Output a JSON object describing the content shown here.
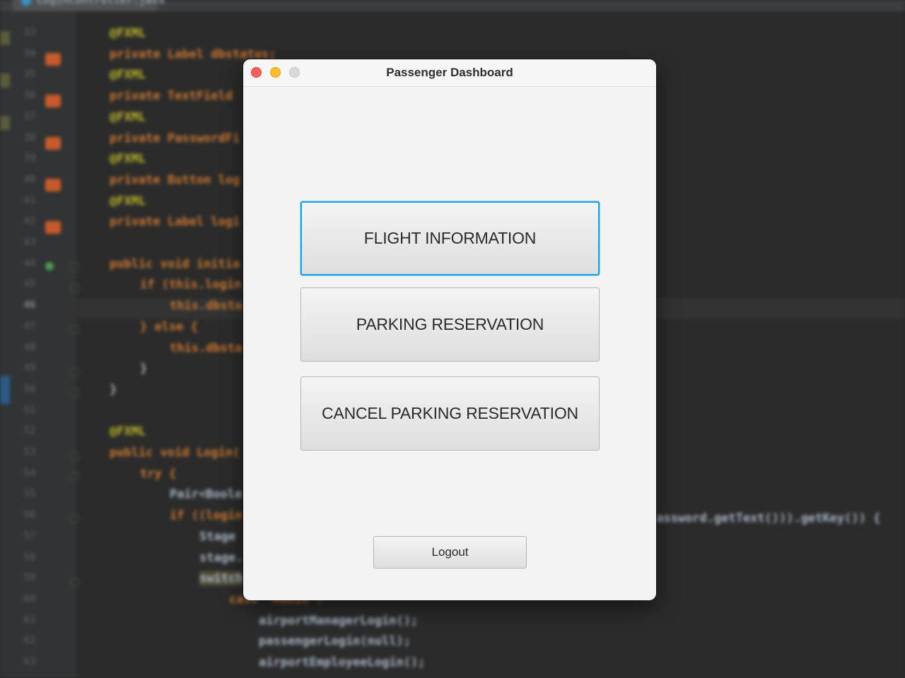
{
  "window": {
    "title": "Passenger Dashboard"
  },
  "buttons": {
    "flight_information": "FLIGHT INFORMATION",
    "parking_reservation": "PARKING RESERVATION",
    "cancel_parking_reservation": "CANCEL PARKING RESERVATION",
    "logout": "Logout"
  },
  "colors": {
    "focus_ring": "#1fa3e0",
    "close": "#fe5f57",
    "minimize": "#febc2e",
    "maximize": "#d9d9d9"
  },
  "background_editor": {
    "tab_label": "LoginController.java",
    "line_numbers": [
      "33",
      "34",
      "35",
      "36",
      "37",
      "38",
      "39",
      "40",
      "41",
      "42",
      "43",
      "44",
      "45",
      "46",
      "47",
      "48",
      "49",
      "50",
      "51",
      "52",
      "53",
      "54",
      "55",
      "56",
      "57",
      "58",
      "59",
      "60",
      "61",
      "62",
      "63"
    ],
    "code_lines": [
      "@FXML",
      "private Label dbstatus;",
      "@FXML",
      "private TextField",
      "@FXML",
      "private PasswordFi",
      "@FXML",
      "private Button log",
      "@FXML",
      "private Label logi",
      "",
      "public void initia",
      "if (this.login",
      "this.dbsta",
      "} else {",
      "this.dbsta",
      "}",
      "}",
      "",
      "@FXML",
      "public void Login(",
      "try {",
      "Pair<Boole",
      "if ((login",
      "Stage",
      "stage.",
      "switch",
      "case \"Admin\":",
      "airportManagerLogin();",
      "passengerLogin(null);",
      "airportEmployeeLogin();"
    ],
    "right_fragment": "assword.getText())).getKey()) {"
  }
}
